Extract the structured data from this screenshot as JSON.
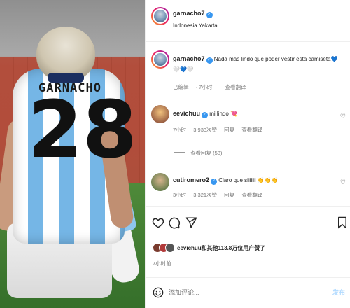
{
  "post": {
    "author": "garnacho7",
    "location": "Indonesia Yakarta",
    "jersey_name": "GARNACHO",
    "jersey_number": "28"
  },
  "caption": {
    "author": "garnacho7",
    "text": "Nada más lindo que poder vestir esta camiseta💙",
    "hearts": "🤍💙🤍",
    "edited": "已编辑",
    "time": "· 7小时",
    "translate": "查看翻译"
  },
  "comments": [
    {
      "user": "eevichuu",
      "text": "mi lindo 💘",
      "time": "7小时",
      "likes": "3,933次赞",
      "reply": "回复",
      "translate": "查看翻译",
      "view_replies": "查看回复 (58)"
    },
    {
      "user": "cutiromero2",
      "text": "Claro que siiiiiii 👏👏👏",
      "time": "3小时",
      "likes": "3,321次赞",
      "reply": "回复",
      "translate": "查看翻译"
    }
  ],
  "likes": {
    "text": "eevichuu和其他113.8万位用户赞了",
    "time": "7小时前"
  },
  "comment_box": {
    "placeholder": "添加评论...",
    "post_label": "发布"
  },
  "icons": {
    "like": "heart-icon",
    "comment": "comment-icon",
    "share": "share-icon",
    "save": "bookmark-icon",
    "emoji": "emoji-icon"
  },
  "colors": {
    "verified": "#3897f0",
    "secondary_text": "#737373",
    "post_button": "#b3dbff"
  }
}
